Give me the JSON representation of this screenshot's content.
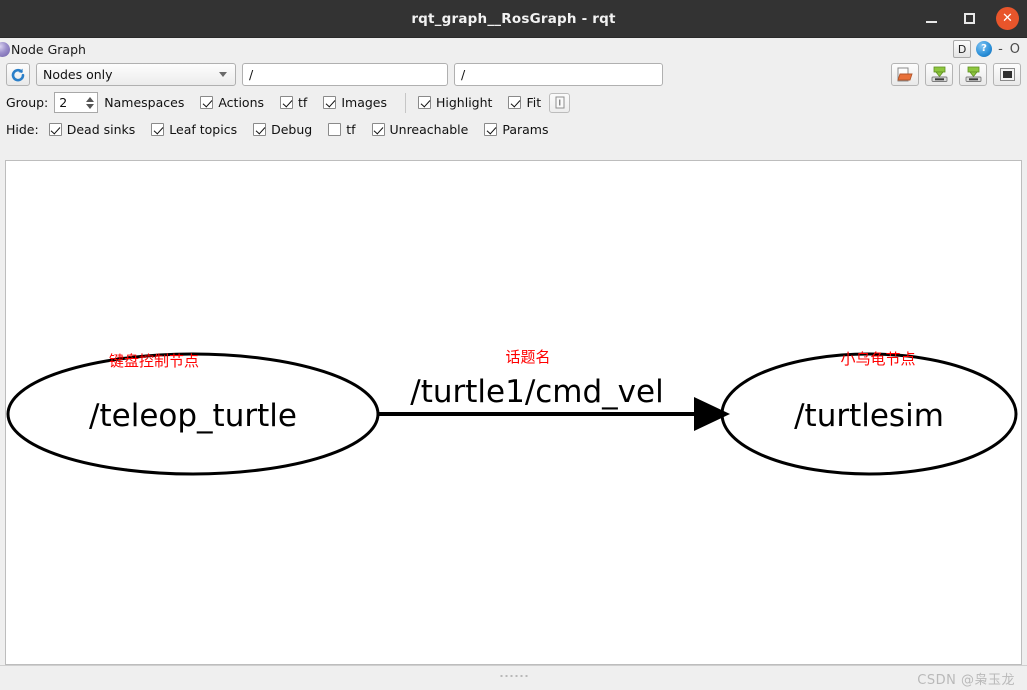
{
  "window": {
    "title": "rqt_graph__RosGraph - rqt",
    "minimize_label": "–",
    "maximize_label": "□",
    "close_label": "✕"
  },
  "panel": {
    "title": "Node Graph",
    "icon": "purple-sphere-icon",
    "pin_label": "D",
    "help_label": "?",
    "float_label": "-",
    "close_label": "O"
  },
  "toolbar": {
    "refresh_icon": "refresh-icon",
    "graph_type": "Nodes only",
    "graph_type_options": [
      "Nodes only"
    ],
    "filter_node": "/",
    "filter_node_placeholder": "/",
    "filter_topic": "/",
    "filter_topic_placeholder": "/",
    "load_dot_icon": "open-folder-icon",
    "save_dot_icon": "save-dot-icon",
    "save_image_icon": "save-image-icon",
    "screenshot_icon": "screenshot-icon"
  },
  "options": {
    "group_label": "Group:",
    "group_value": "2",
    "namespaces_label": "Namespaces",
    "actions_label": "Actions",
    "actions_checked": true,
    "tf_label": "tf",
    "tf_checked": true,
    "images_label": "Images",
    "images_checked": true,
    "highlight_label": "Highlight",
    "highlight_checked": true,
    "fit_label": "Fit",
    "fit_checked": true,
    "fit_button_label": "1"
  },
  "hide": {
    "label": "Hide:",
    "items": [
      {
        "label": "Dead sinks",
        "checked": true
      },
      {
        "label": "Leaf topics",
        "checked": true
      },
      {
        "label": "Debug",
        "checked": true
      },
      {
        "label": "tf",
        "checked": false
      },
      {
        "label": "Unreachable",
        "checked": true
      },
      {
        "label": "Params",
        "checked": true
      }
    ]
  },
  "graph": {
    "node_left": "/teleop_turtle",
    "node_right": "/turtlesim",
    "topic": "/turtle1/cmd_vel",
    "anno_left": "键盘控制节点",
    "anno_topic": "话题名",
    "anno_right": "小乌龟节点",
    "anno_color": "#ff0000"
  },
  "status": {
    "watermark": "CSDN @枭玉龙"
  }
}
